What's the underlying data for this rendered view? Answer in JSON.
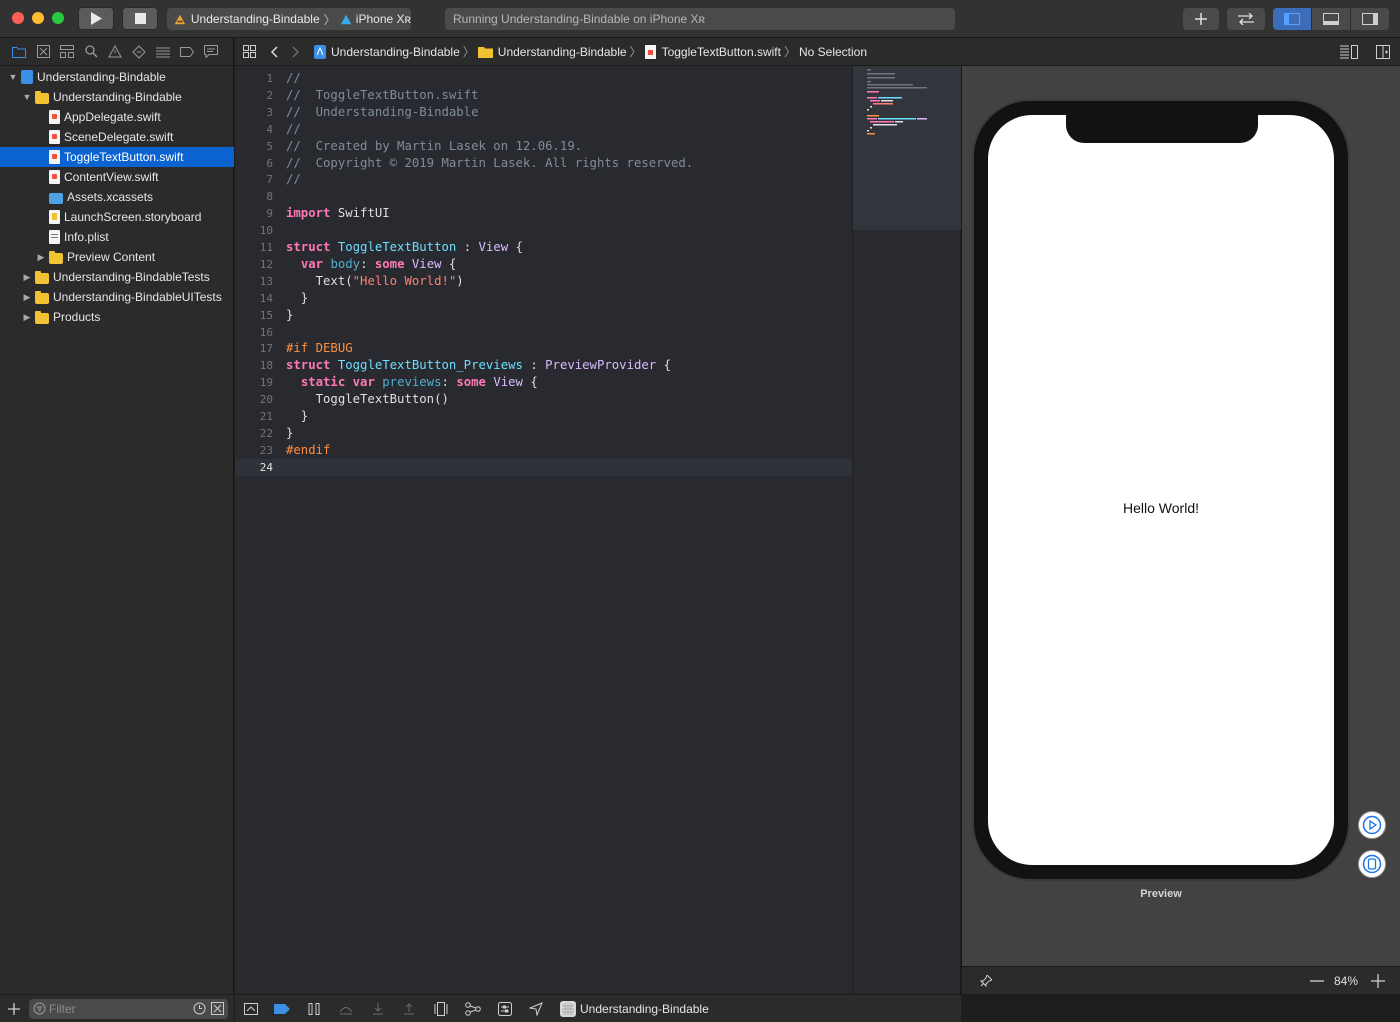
{
  "toolbar": {
    "scheme_name": "Understanding-Bindable",
    "device_name": "iPhone Xʀ",
    "activity_text": "Running Understanding-Bindable on iPhone Xʀ"
  },
  "navigator": {
    "items": [
      {
        "label": "Understanding-Bindable",
        "kind": "project",
        "expanded": true
      },
      {
        "label": "Understanding-Bindable",
        "kind": "folder",
        "expanded": true
      },
      {
        "label": "AppDelegate.swift",
        "kind": "swift"
      },
      {
        "label": "SceneDelegate.swift",
        "kind": "swift"
      },
      {
        "label": "ToggleTextButton.swift",
        "kind": "swift",
        "selected": true
      },
      {
        "label": "ContentView.swift",
        "kind": "swift"
      },
      {
        "label": "Assets.xcassets",
        "kind": "assets"
      },
      {
        "label": "LaunchScreen.storyboard",
        "kind": "storyboard"
      },
      {
        "label": "Info.plist",
        "kind": "plist"
      },
      {
        "label": "Preview Content",
        "kind": "folder",
        "expanded": false
      },
      {
        "label": "Understanding-BindableTests",
        "kind": "folder",
        "expanded": false
      },
      {
        "label": "Understanding-BindableUITests",
        "kind": "folder",
        "expanded": false
      },
      {
        "label": "Products",
        "kind": "folder",
        "expanded": false
      }
    ],
    "filter_placeholder": "Filter"
  },
  "jumpbar": {
    "project": "Understanding-Bindable",
    "group": "Understanding-Bindable",
    "file": "ToggleTextButton.swift",
    "selection": "No Selection"
  },
  "editor": {
    "lines": [
      "//",
      "//  ToggleTextButton.swift",
      "//  Understanding-Bindable",
      "//",
      "//  Created by Martin Lasek on 12.06.19.",
      "//  Copyright © 2019 Martin Lasek. All rights reserved.",
      "//",
      "",
      "import SwiftUI",
      "",
      "struct ToggleTextButton : View {",
      "  var body: some View {",
      "    Text(\"Hello World!\")",
      "  }",
      "}",
      "",
      "#if DEBUG",
      "struct ToggleTextButton_Previews : PreviewProvider {",
      "  static var previews: some View {",
      "    ToggleTextButton()",
      "  }",
      "}",
      "#endif",
      ""
    ],
    "current_line": 24
  },
  "canvas": {
    "preview_text": "Hello World!",
    "preview_label": "Preview",
    "zoom": "84%"
  },
  "debugbar": {
    "target_label": "Understanding-Bindable"
  }
}
